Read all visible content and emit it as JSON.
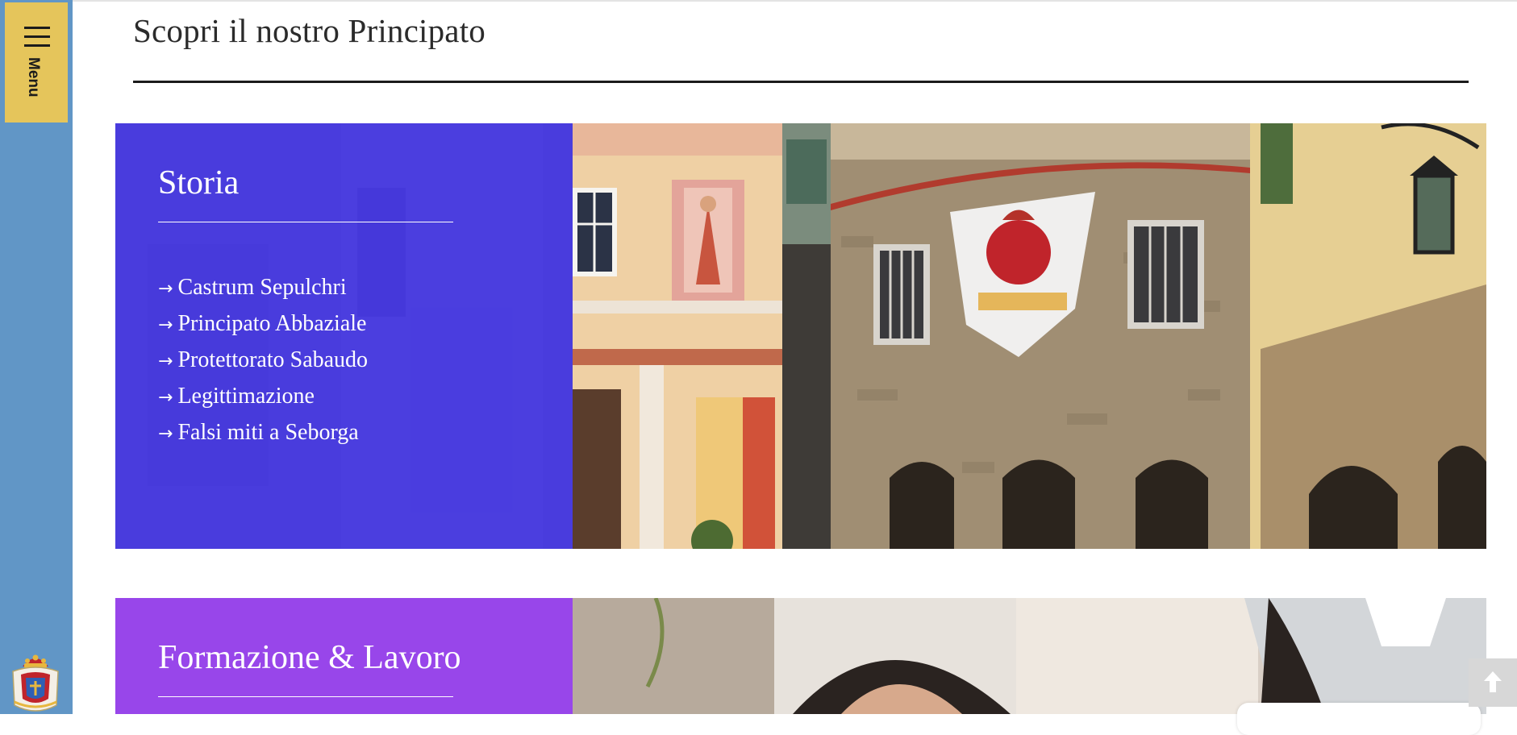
{
  "sidebar": {
    "menu_label": "Menu",
    "menu_icon": "hamburger-icon",
    "crest": "coat-of-arms-logo"
  },
  "header": {
    "title": "Scopri il nostro Principato"
  },
  "cards": [
    {
      "title": "Storia",
      "links": [
        "Castrum Sepulchri",
        "Principato Abbaziale",
        "Protettorato Sabaudo",
        "Legittimazione",
        "Falsi miti a Seborga"
      ],
      "link_arrow": "→",
      "panel_color": "#3e31e2"
    },
    {
      "title": "Formazione & Lavoro",
      "panel_color": "#943eec"
    }
  ],
  "back_to_top": {
    "icon": "arrow-up-icon"
  },
  "colors": {
    "sidebar": "#6196c6",
    "menu_button": "#e5c55b"
  }
}
